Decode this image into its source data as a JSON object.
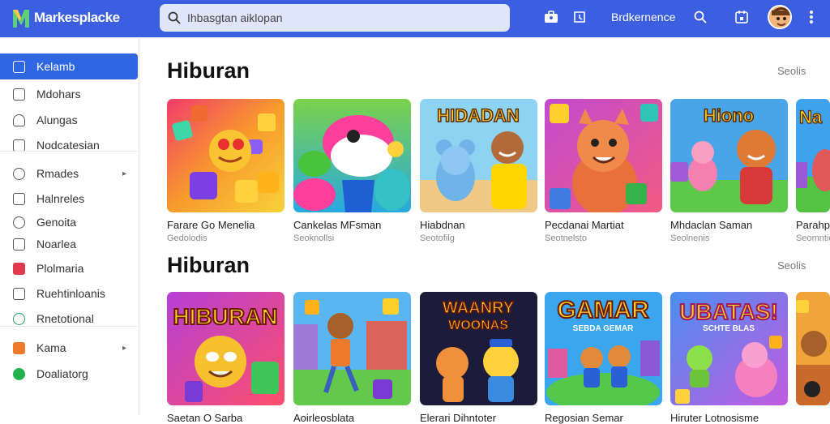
{
  "app": {
    "name": "Markesplacke"
  },
  "search": {
    "value": "Ihbasgtan aiklopan"
  },
  "topbar": {
    "link_label": "Brdkernence",
    "icons": [
      "briefcase-icon",
      "history-icon",
      "search-icon",
      "calendar-icon",
      "more-vert-icon"
    ]
  },
  "sidebar": {
    "items": [
      {
        "label": "Kelamb",
        "icon": "play-icon",
        "active": true
      },
      {
        "label": "Mdohars",
        "icon": "square-icon"
      },
      {
        "label": "Alungas",
        "icon": "headset-icon"
      },
      {
        "label": "Nodcatesian",
        "icon": "bell-icon"
      },
      {
        "label": "Rmades",
        "icon": "circle-icon",
        "chevron": true
      },
      {
        "label": "Halnreles",
        "icon": "square-icon"
      },
      {
        "label": "Genoita",
        "icon": "refresh-icon"
      },
      {
        "label": "Noarlea",
        "icon": "square-icon"
      },
      {
        "label": "Plolmaria",
        "icon": "music-icon",
        "color": "#e23a4d"
      },
      {
        "label": "Ruehtinloanis",
        "icon": "edit-icon"
      },
      {
        "label": "Rnetotional",
        "icon": "check-circle-icon",
        "color": "#21a366"
      },
      {
        "label": "Kama",
        "icon": "square-icon",
        "color": "#ee7a2c",
        "chevron": true
      },
      {
        "label": "Doaliatorg",
        "icon": "check-circle-icon",
        "color": "#22b24c"
      }
    ]
  },
  "sections": [
    {
      "title": "Hiburan",
      "link": "Seolis",
      "cards": [
        {
          "title": "Farare Go Menelia",
          "sub": "Gedolodis",
          "art": "blocks"
        },
        {
          "title": "Cankelas MFsman",
          "sub": "Seoknollsi",
          "art": "whale"
        },
        {
          "title": "Hiabdnan",
          "sub": "Seotofilg",
          "art": "hidadan",
          "banner": "HIDADAN"
        },
        {
          "title": "Pecdanai Martiat",
          "sub": "Seotnelsto",
          "art": "bear"
        },
        {
          "title": "Mhdaclan Saman",
          "sub": "Seolnenis",
          "art": "hirono",
          "banner": "Hiono"
        },
        {
          "title": "Parahpe",
          "sub": "Seomntioi",
          "art": "partial",
          "banner": "Na"
        }
      ]
    },
    {
      "title": "Hiburan",
      "link": "Seolis",
      "cards": [
        {
          "title": "Saetan O Sarba",
          "sub": "",
          "art": "hiburan",
          "banner": "HIBURAN"
        },
        {
          "title": "Aoirleosblata",
          "sub": "",
          "art": "runner"
        },
        {
          "title": "Elerari Dihntoter",
          "sub": "",
          "art": "waanry",
          "banner": "WAANRY",
          "banner2": "WOONAS"
        },
        {
          "title": "Regosian Semar",
          "sub": "",
          "art": "gamar",
          "banner": "GAMAR",
          "banner2": "SEBDA GEMAR"
        },
        {
          "title": "Hiruter Lotnosisme",
          "sub": "",
          "art": "ubatas",
          "banner": "UBATAS!",
          "banner2": "SCHTE BLAS"
        },
        {
          "title": "",
          "sub": "",
          "art": "partial2"
        }
      ]
    }
  ]
}
